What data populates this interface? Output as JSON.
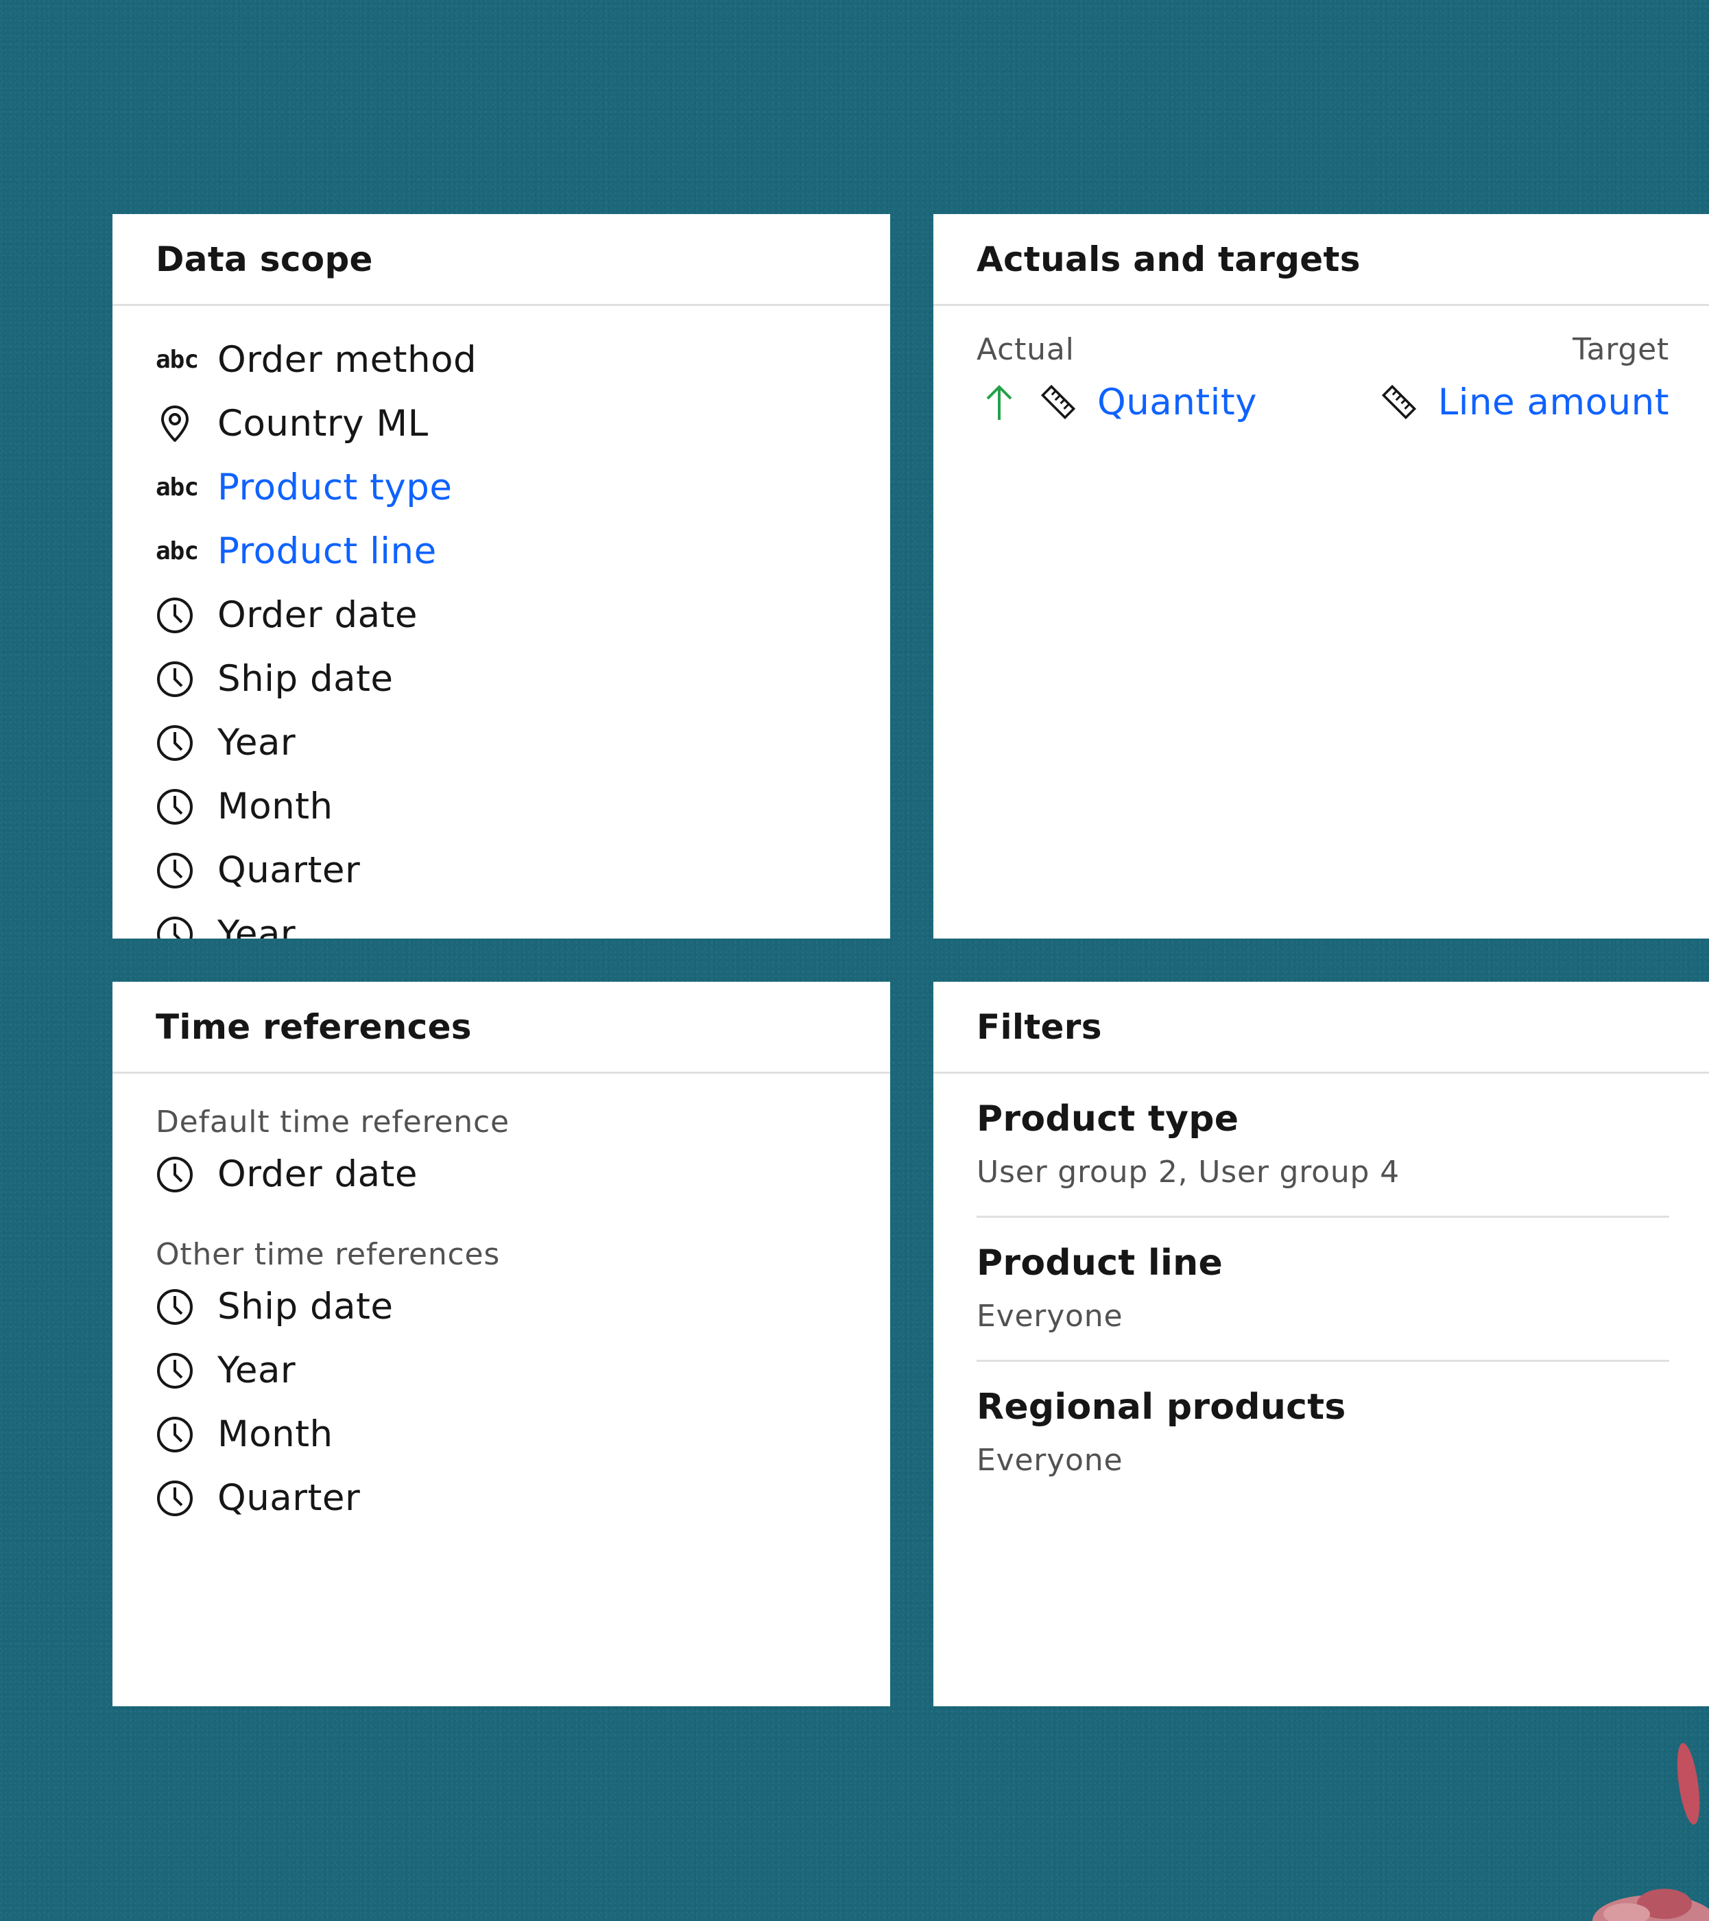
{
  "data_scope": {
    "title": "Data scope",
    "items": [
      {
        "icon": "abc-icon",
        "label": "Order method",
        "link": false
      },
      {
        "icon": "location-icon",
        "label": "Country ML",
        "link": false
      },
      {
        "icon": "abc-icon",
        "label": "Product type",
        "link": true
      },
      {
        "icon": "abc-icon",
        "label": "Product line",
        "link": true
      },
      {
        "icon": "clock-icon",
        "label": "Order date",
        "link": false
      },
      {
        "icon": "clock-icon",
        "label": "Ship date",
        "link": false
      },
      {
        "icon": "clock-icon",
        "label": "Year",
        "link": false
      },
      {
        "icon": "clock-icon",
        "label": "Month",
        "link": false
      },
      {
        "icon": "clock-icon",
        "label": "Quarter",
        "link": false
      },
      {
        "icon": "clock-icon",
        "label": "Year",
        "link": false
      }
    ],
    "abc_text": "abc"
  },
  "actuals_targets": {
    "title": "Actuals and targets",
    "actual_label": "Actual",
    "target_label": "Target",
    "actual_item": "Quantity",
    "target_item": "Line amount",
    "colors": {
      "arrow": "#24a148",
      "link": "#0f62fe"
    }
  },
  "time_references": {
    "title": "Time references",
    "default_label": "Default time reference",
    "default_item": "Order date",
    "other_label": "Other time references",
    "other_items": [
      "Ship date",
      "Year",
      "Month",
      "Quarter"
    ]
  },
  "filters": {
    "title": "Filters",
    "items": [
      {
        "name": "Product type",
        "value": "User group 2, User group 4"
      },
      {
        "name": "Product line",
        "value": "Everyone"
      },
      {
        "name": "Regional products",
        "value": "Everyone"
      }
    ]
  },
  "colors": {
    "background": "#1b6779",
    "link": "#0f62fe",
    "text": "#161616",
    "secondary_text": "#525252",
    "divider": "#e0e0e0"
  }
}
